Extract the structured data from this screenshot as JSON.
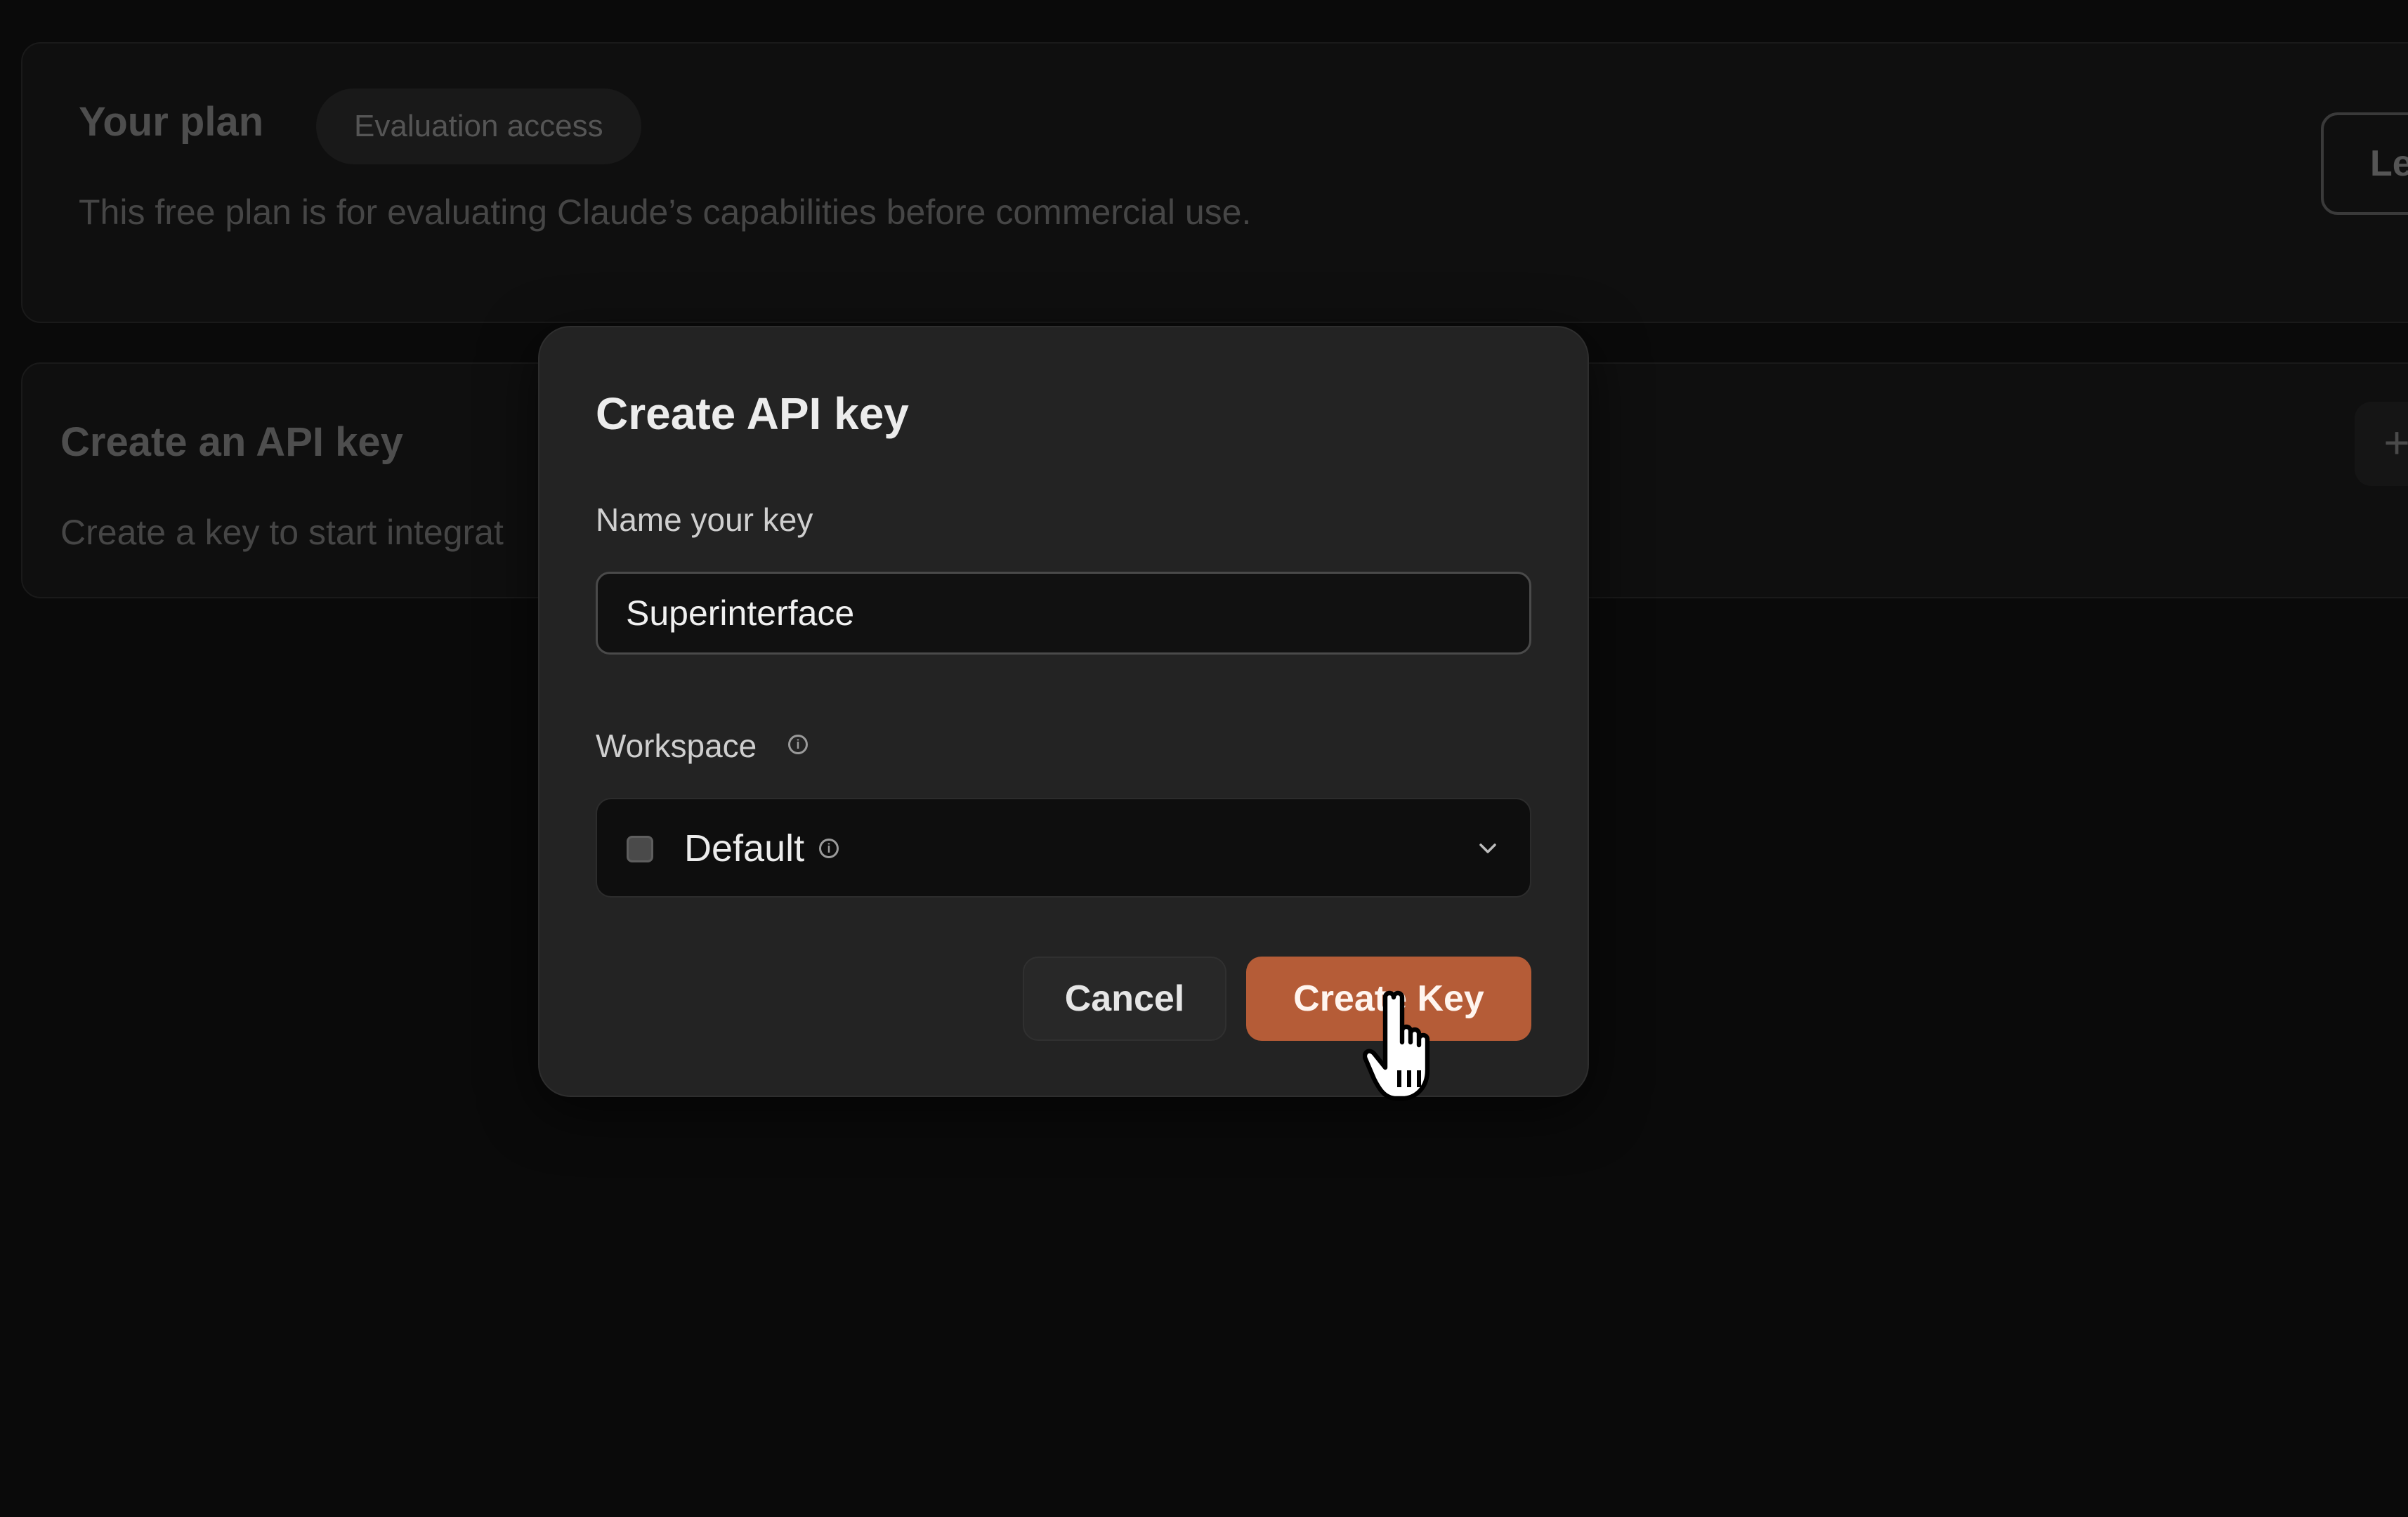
{
  "plan": {
    "title": "Your plan",
    "badge": "Evaluation access",
    "description": "This free plan is for evaluating Claude’s capabilities before commercial use.",
    "button_label": "Le"
  },
  "api_card": {
    "title": "Create an API key",
    "description": "Create a key to start integrat",
    "add_label": "+"
  },
  "modal": {
    "title": "Create API key",
    "name_label": "Name your key",
    "name_value": "Superinterface",
    "workspace_label": "Workspace",
    "workspace_value": "Default",
    "info_glyph": "i",
    "cancel_label": "Cancel",
    "create_label": "Create Key"
  },
  "colors": {
    "accent": "#b55c37",
    "modal_bg": "#232323",
    "page_bg": "#0a0a0a"
  },
  "icons": {
    "workspace_info": "info-icon",
    "select_chevron": "chevron-down-icon",
    "cursor": "hand-pointer-icon"
  }
}
